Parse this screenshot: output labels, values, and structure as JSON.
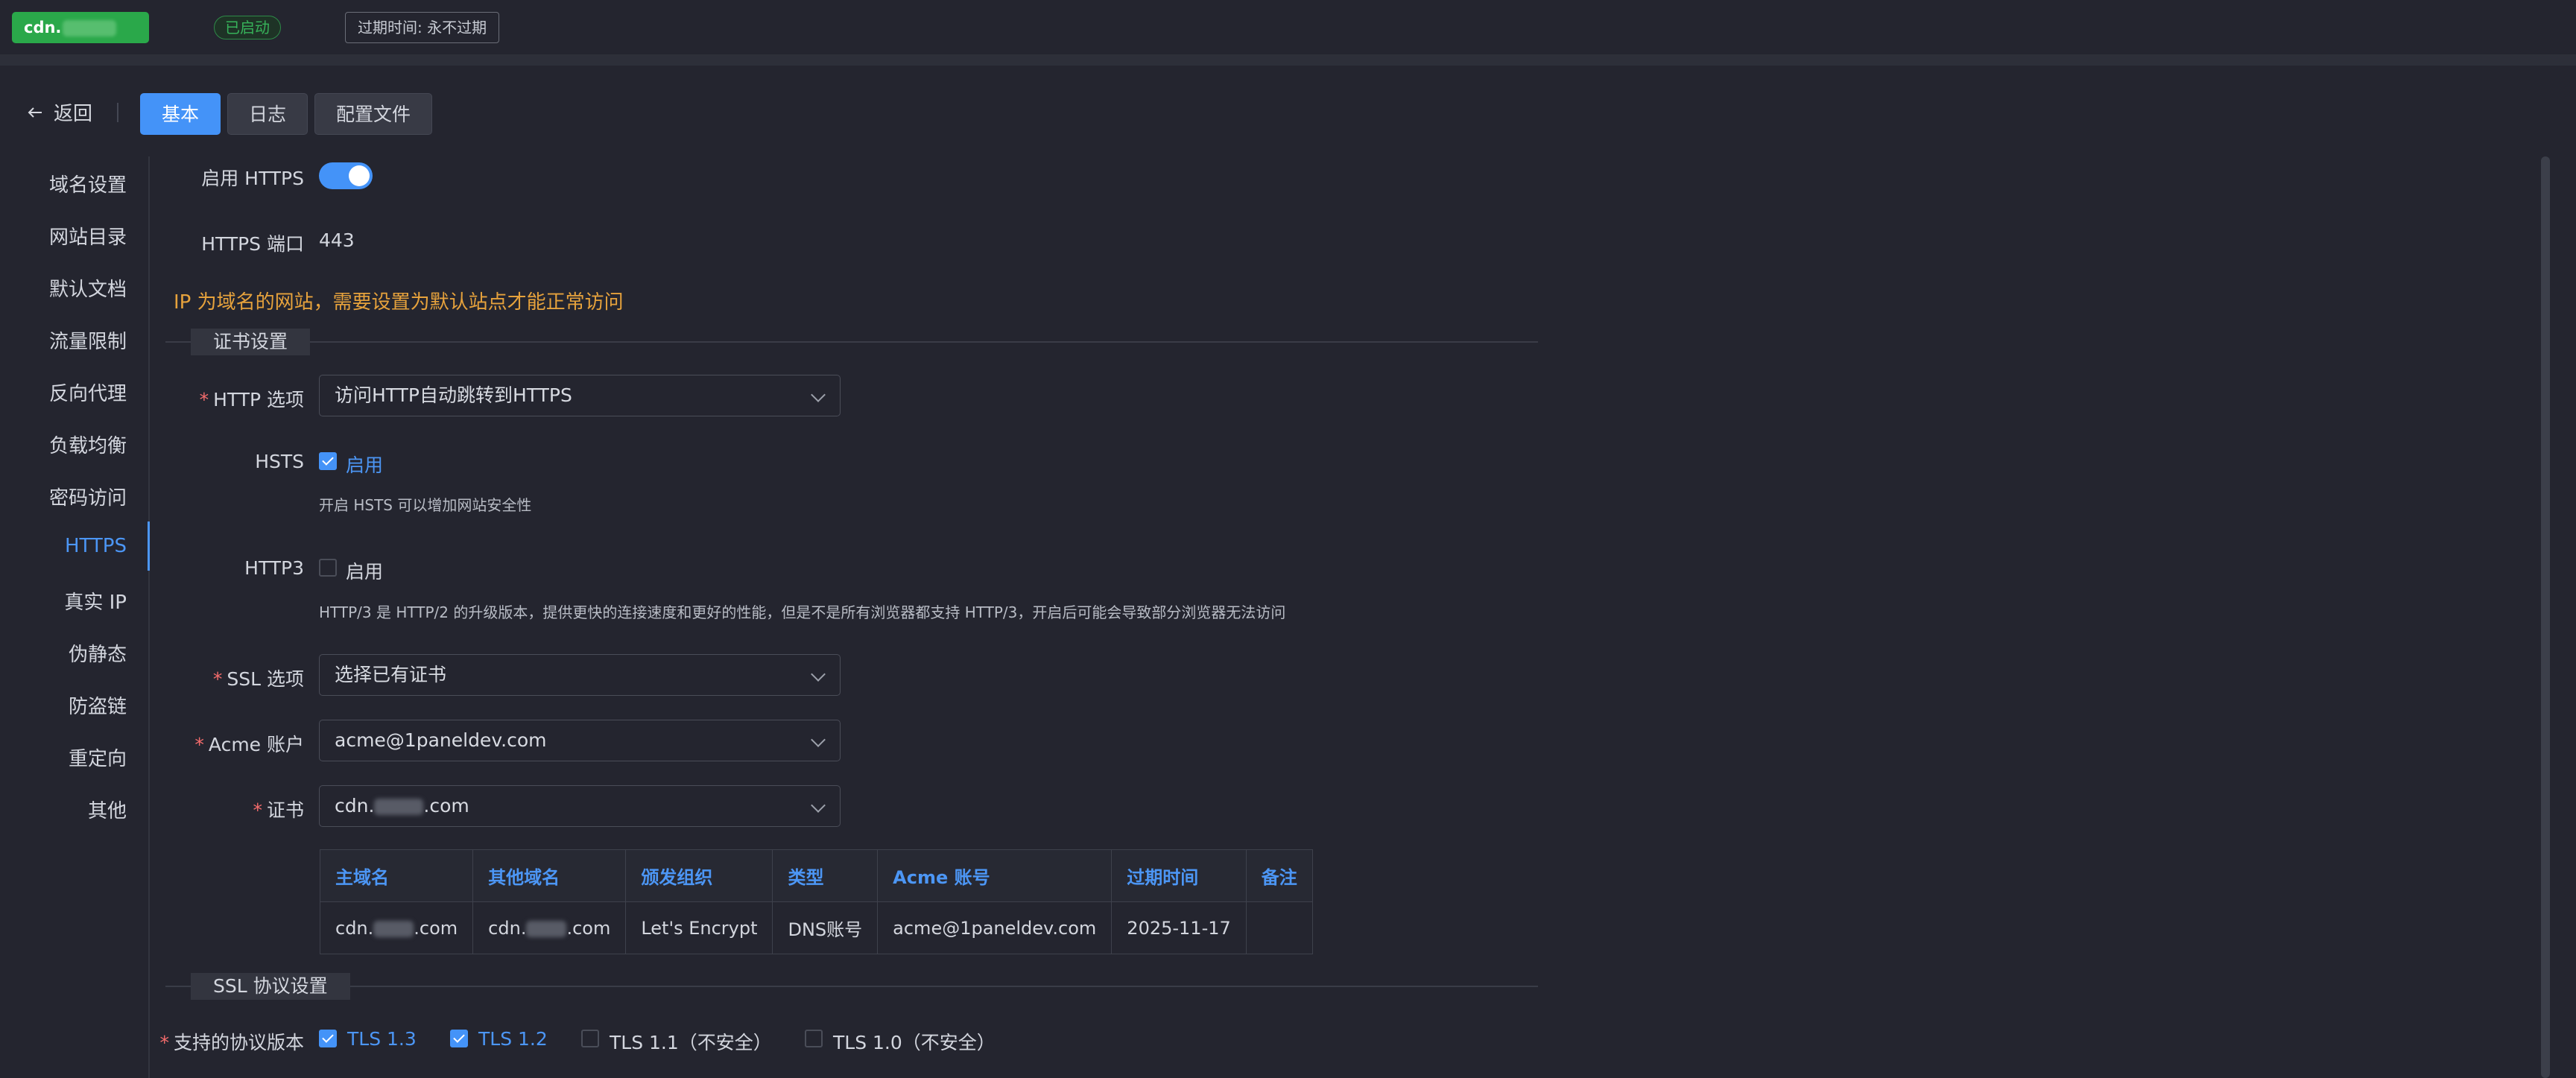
{
  "topbar": {
    "site_prefix": "cdn.",
    "site_suffix": ".com",
    "status": "已启动",
    "expire": "过期时间: 永不过期"
  },
  "toolbar": {
    "back_label": "返回",
    "tabs": [
      {
        "label": "基本",
        "active": true
      },
      {
        "label": "日志",
        "active": false
      },
      {
        "label": "配置文件",
        "active": false
      }
    ]
  },
  "sidebar": {
    "items": [
      {
        "label": "域名设置"
      },
      {
        "label": "网站目录"
      },
      {
        "label": "默认文档"
      },
      {
        "label": "流量限制"
      },
      {
        "label": "反向代理"
      },
      {
        "label": "负载均衡"
      },
      {
        "label": "密码访问"
      },
      {
        "label": "HTTPS",
        "active": true
      },
      {
        "label": "真实 IP"
      },
      {
        "label": "伪静态"
      },
      {
        "label": "防盗链"
      },
      {
        "label": "重定向"
      },
      {
        "label": "其他"
      }
    ]
  },
  "form": {
    "enable_https_label": "启用 HTTPS",
    "enable_https": true,
    "https_port_label": "HTTPS 端口",
    "https_port": "443",
    "warning": "IP 为域名的网站，需要设置为默认站点才能正常访问",
    "cert_section": "证书设置",
    "http_option_label": "HTTP 选项",
    "http_option_value": "访问HTTP自动跳转到HTTPS",
    "hsts_label": "HSTS",
    "hsts_checkbox": "启用",
    "hsts_checked": true,
    "hsts_hint": "开启 HSTS 可以增加网站安全性",
    "http3_label": "HTTP3",
    "http3_checkbox": "启用",
    "http3_checked": false,
    "http3_hint": "HTTP/3 是 HTTP/2 的升级版本，提供更快的连接速度和更好的性能，但是不是所有浏览器都支持 HTTP/3，开启后可能会导致部分浏览器无法访问",
    "ssl_option_label": "SSL 选项",
    "ssl_option_value": "选择已有证书",
    "acme_label": "Acme 账户",
    "acme_value": "acme@1paneldev.com",
    "cert_label": "证书",
    "cert_value_prefix": "cdn.",
    "cert_value_suffix": ".com",
    "ssl_proto_section": "SSL 协议设置",
    "proto_label": "支持的协议版本",
    "protocols": [
      {
        "label": "TLS 1.3",
        "checked": true
      },
      {
        "label": "TLS 1.2",
        "checked": true
      },
      {
        "label": "TLS 1.1（不安全）",
        "checked": false
      },
      {
        "label": "TLS 1.0（不安全）",
        "checked": false
      }
    ]
  },
  "cert_table": {
    "headers": [
      "主域名",
      "其他域名",
      "颁发组织",
      "类型",
      "Acme 账号",
      "过期时间",
      "备注"
    ],
    "row": {
      "primary_prefix": "cdn.",
      "primary_suffix": ".com",
      "other_prefix": "cdn.",
      "other_suffix": ".com",
      "issuer": "Let's Encrypt",
      "type": "DNS账号",
      "acme": "acme@1paneldev.com",
      "expire": "2025-11-17",
      "remark": ""
    }
  },
  "colors": {
    "accent": "#4493f8",
    "success": "#2aa84a",
    "warning": "#e6a23c",
    "danger": "#f56c6c",
    "background": "#24252f"
  }
}
